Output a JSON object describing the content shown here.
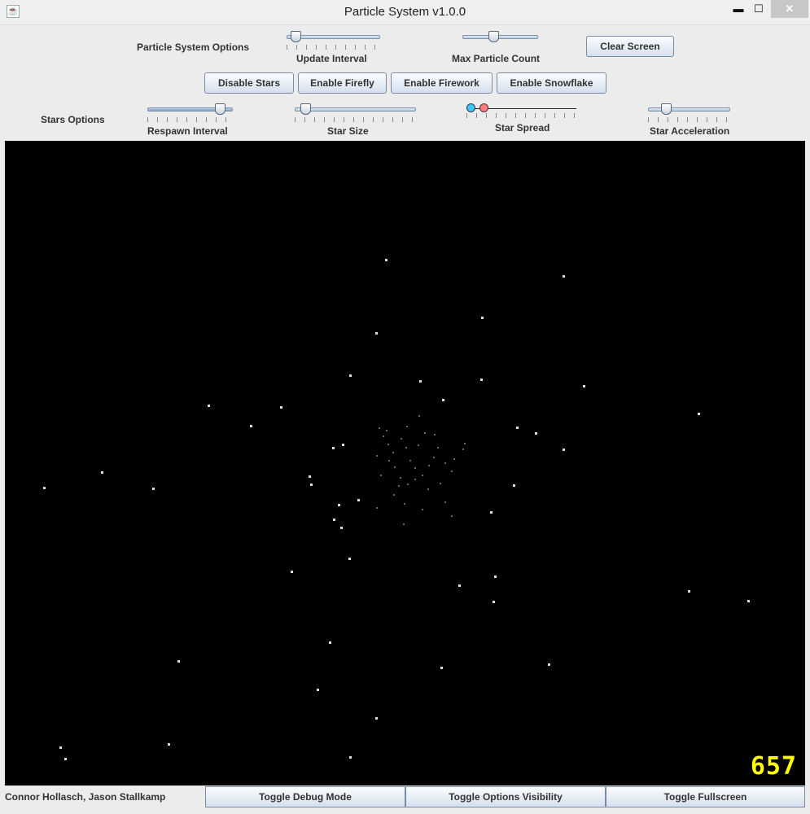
{
  "window": {
    "title": "Particle System v1.0.0",
    "minimize": "▬",
    "maximize": "☐",
    "close": "✕",
    "icon": "java-icon"
  },
  "options": {
    "particle_system_label": "Particle System Options",
    "update_interval_label": "Update Interval",
    "max_particle_count_label": "Max Particle Count",
    "clear_screen": "Clear Screen",
    "update_interval_value": 0.05,
    "max_particle_count_value": 0.4
  },
  "effect_buttons": {
    "stars": "Disable Stars",
    "firefly": "Enable Firefly",
    "firework": "Enable Firework",
    "snowflake": "Enable Snowflake"
  },
  "stars_options": {
    "label": "Stars Options",
    "respawn_interval_label": "Respawn Interval",
    "respawn_interval_value": 0.9,
    "star_size_label": "Star Size",
    "star_size_value": 0.05,
    "star_spread_label": "Star Spread",
    "star_spread_low": 0.0,
    "star_spread_high": 0.13,
    "star_acceleration_label": "Star Acceleration",
    "star_acceleration_value": 0.18
  },
  "canvas": {
    "particle_count": "657"
  },
  "footer": {
    "credits": "Connor Hollasch, Jason Stallkamp",
    "toggle_debug": "Toggle Debug Mode",
    "toggle_options": "Toggle Options Visibility",
    "toggle_fullscreen": "Toggle Fullscreen"
  },
  "colors": {
    "canvas_bg": "#000000",
    "counter": "#ffff00",
    "spread_low_knob": "#3cc8ff",
    "spread_high_knob": "#ff7d7d"
  }
}
